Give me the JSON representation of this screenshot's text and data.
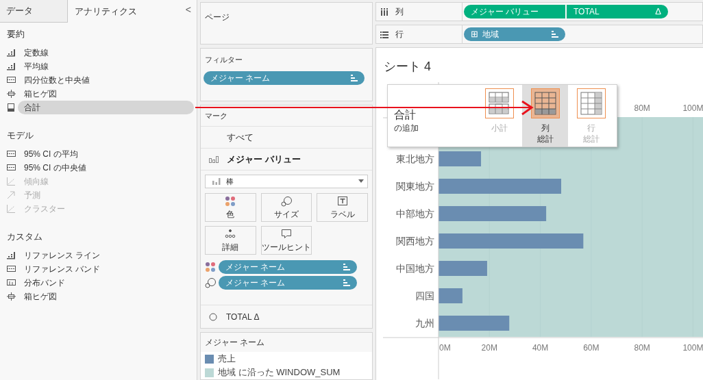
{
  "left_panel": {
    "tabs": [
      {
        "label": "データ",
        "selected": false
      },
      {
        "label": "アナリティクス",
        "selected": true
      }
    ],
    "collapse": "<",
    "sections": [
      {
        "title": "要約",
        "items": [
          {
            "label": "定数線",
            "disabled": false,
            "selected": false
          },
          {
            "label": "平均線",
            "disabled": false,
            "selected": false
          },
          {
            "label": "四分位数と中央値",
            "disabled": false,
            "selected": false
          },
          {
            "label": "箱ヒゲ図",
            "disabled": false,
            "selected": false
          },
          {
            "label": "合計",
            "disabled": false,
            "selected": true
          }
        ]
      },
      {
        "title": "モデル",
        "items": [
          {
            "label": "95% CI の平均",
            "disabled": false,
            "selected": false
          },
          {
            "label": "95% CI の中央値",
            "disabled": false,
            "selected": false
          },
          {
            "label": "傾向線",
            "disabled": true,
            "selected": false
          },
          {
            "label": "予測",
            "disabled": true,
            "selected": false
          },
          {
            "label": "クラスター",
            "disabled": true,
            "selected": false
          }
        ]
      },
      {
        "title": "カスタム",
        "items": [
          {
            "label": "リファレンス ライン",
            "disabled": false,
            "selected": false
          },
          {
            "label": "リファレンス バンド",
            "disabled": false,
            "selected": false
          },
          {
            "label": "分布バンド",
            "disabled": false,
            "selected": false
          },
          {
            "label": "箱ヒゲ図",
            "disabled": false,
            "selected": false
          }
        ]
      }
    ]
  },
  "pages": {
    "title": "ページ"
  },
  "filters": {
    "title": "フィルター",
    "pills": [
      "メジャー ネーム"
    ]
  },
  "marks": {
    "title": "マーク",
    "all": "すべて",
    "measure": "メジャー バリュー",
    "mark_type": "棒",
    "buttons": [
      "色",
      "サイズ",
      "ラベル",
      "詳細",
      "ツールヒント"
    ],
    "pills": [
      "メジャー ネーム",
      "メジャー ネーム"
    ],
    "total": "TOTAL Δ"
  },
  "legend": {
    "title": "メジャー ネーム",
    "items": [
      {
        "label": "売上",
        "color": "#6a8db1"
      },
      {
        "label": "地域 に沿った WINDOW_SUM",
        "color": "#bcd9d6"
      }
    ]
  },
  "shelves": [
    {
      "label": "列",
      "pills": [
        {
          "text": "メジャー バリュー",
          "color": "#00b17f"
        },
        {
          "text": "TOTAL",
          "icon": "Δ",
          "color": "#00b17f"
        }
      ]
    },
    {
      "label": "行",
      "pills": [
        {
          "text": "地域",
          "prefix": "⊞",
          "color": "#4a98b3"
        }
      ]
    }
  ],
  "sheet": {
    "title": "シート 4",
    "top_axis_labels": [
      "80M",
      "100M"
    ],
    "chart_data": {
      "type": "bar",
      "orientation": "horizontal",
      "categories": [
        "東北地方",
        "関東地方",
        "中部地方",
        "関西地方",
        "中国地方",
        "四国",
        "九州"
      ],
      "grid": true,
      "series": [
        {
          "color": "#6a8db1",
          "values": [
            16.7,
            48.2,
            42.3,
            56.9,
            19.1,
            9.4,
            27.8
          ]
        }
      ],
      "xlim": [
        0,
        105
      ],
      "xticks": [
        {
          "value": 0,
          "label": "0M"
        },
        {
          "value": 20,
          "label": "20M"
        },
        {
          "value": 40,
          "label": "40M"
        },
        {
          "value": 60,
          "label": "60M"
        },
        {
          "value": 80,
          "label": "80M"
        },
        {
          "value": 100,
          "label": "100M"
        }
      ]
    }
  },
  "popup": {
    "title": "合計",
    "subtitle": "の追加",
    "options": [
      {
        "lines": [
          "小計"
        ],
        "selected": false
      },
      {
        "lines": [
          "列",
          "総計"
        ],
        "selected": true
      },
      {
        "lines": [
          "行",
          "総計"
        ],
        "selected": false
      }
    ]
  }
}
